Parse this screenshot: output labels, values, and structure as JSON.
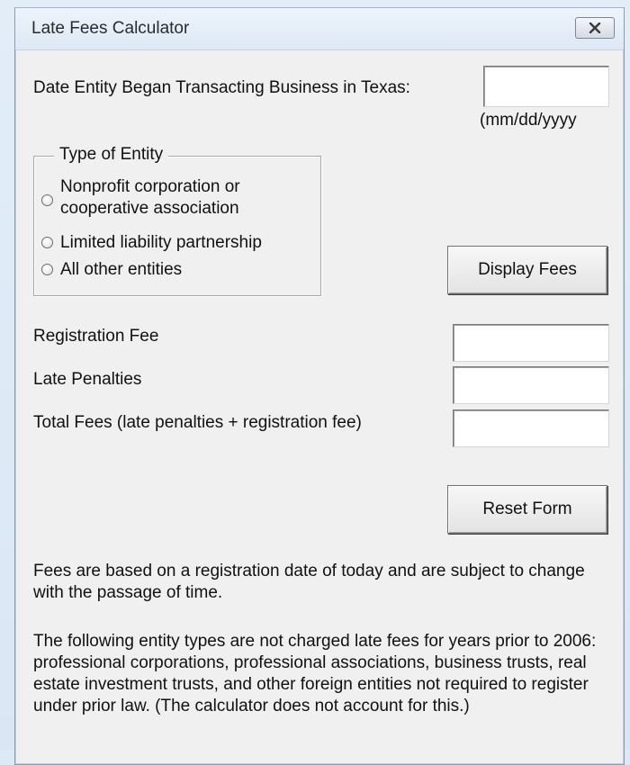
{
  "window": {
    "title": "Late Fees Calculator",
    "close_icon": "close-icon"
  },
  "form": {
    "date_label": "Date Entity Began Transacting Business in Texas:",
    "date_value": "",
    "date_format_hint": "(mm/dd/yyyy",
    "entity_group": {
      "legend": "Type of Entity",
      "options": [
        {
          "label_line1": "Nonprofit corporation or",
          "label_line2": "cooperative association",
          "selected": false
        },
        {
          "label_line1": "Limited liability partnership",
          "selected": false
        },
        {
          "label_line1": "All other entities",
          "selected": false
        }
      ]
    },
    "display_fees_button": "Display Fees",
    "registration_fee_label": "Registration Fee",
    "registration_fee_value": "",
    "late_penalties_label": "Late Penalties",
    "late_penalties_value": "",
    "total_fees_label": "Total Fees (late penalties + registration fee)",
    "total_fees_value": "",
    "reset_button": "Reset Form"
  },
  "notes": {
    "paragraph1": "Fees are based on a registration date of today and are subject to change with the passage of time.",
    "paragraph2": "The following entity types are not charged late fees for years prior to 2006: professional corporations, professional associations, business trusts, real estate investment trusts, and other foreign entities not required to register under prior law. (The calculator does not account for this.)"
  }
}
